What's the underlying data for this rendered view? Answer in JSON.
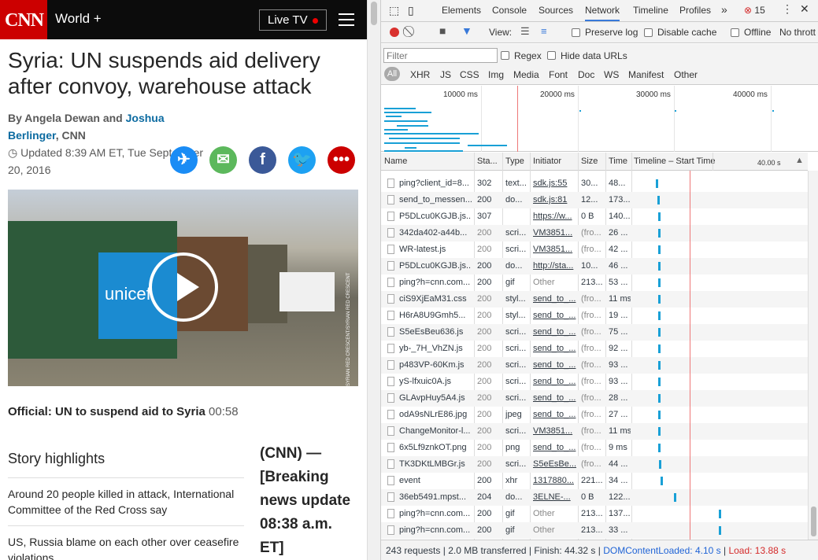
{
  "cnn": {
    "logo": "CNN",
    "section": "World +",
    "live_tv": "Live TV",
    "headline": "Syria: UN suspends aid delivery after convoy, warehouse attack",
    "byline_by": "By Angela Dewan and ",
    "byline_author2": "Joshua Berlinger",
    "byline_org": ", CNN",
    "updated": "Updated 8:39 AM ET, Tue September 20, 2016",
    "video_caption_title": "Official: UN to suspend aid to Syria",
    "video_caption_duration": "00:58",
    "highlights_title": "Story highlights",
    "highlights": [
      "Around 20 people killed in attack, International Committee of the Red Cross say",
      "US, Russia blame on each other over ceasefire violations"
    ],
    "lede": "(CNN) — [Breaking news update 08:38 a.m. ET]",
    "share_colors": {
      "messenger": "#1a8cf5",
      "email": "#5cb85c",
      "facebook": "#3b5998",
      "twitter": "#1da1f2",
      "more": "#cc0000"
    },
    "video_text": "unicef",
    "video_credit": "SYRIAN RED CRESCENT/SYRIAN RED CRESCENT"
  },
  "devtools": {
    "tabs": [
      "Elements",
      "Console",
      "Sources",
      "Network",
      "Timeline",
      "Profiles"
    ],
    "active_tab": "Network",
    "error_count": "15",
    "view_label": "View:",
    "preserve_log": "Preserve log",
    "disable_cache": "Disable cache",
    "offline": "Offline",
    "throttle": "No thrott",
    "filter_placeholder": "Filter",
    "regex": "Regex",
    "hide_data_urls": "Hide data URLs",
    "filter_types": [
      "All",
      "XHR",
      "JS",
      "CSS",
      "Img",
      "Media",
      "Font",
      "Doc",
      "WS",
      "Manifest",
      "Other"
    ],
    "overview_ticks": [
      "10000 ms",
      "20000 ms",
      "30000 ms",
      "40000 ms"
    ],
    "columns": [
      "Name",
      "Sta...",
      "Type",
      "Initiator",
      "Size",
      "Time",
      "Timeline – Start Time",
      "40.00 s"
    ],
    "rows": [
      {
        "name": "ping?client_id=8...",
        "status": "302",
        "type": "text...",
        "initiator": "sdk.js:55",
        "size": "30...",
        "time": "48...",
        "wf": 0.14,
        "link": true,
        "muted": false
      },
      {
        "name": "send_to_messen...",
        "status": "200",
        "type": "do...",
        "initiator": "sdk.js:81",
        "size": "12...",
        "time": "173...",
        "wf": 0.15,
        "link": true,
        "muted": false
      },
      {
        "name": "P5DLcu0KGJB.js...",
        "status": "307",
        "type": "",
        "initiator": "https://w...",
        "size": "0 B",
        "time": "140...",
        "wf": 0.155,
        "link": true,
        "muted": false
      },
      {
        "name": "342da402-a44b...",
        "status": "200",
        "type": "scri...",
        "initiator": "VM3851...",
        "size": "(fro...",
        "time": "26 ...",
        "wf": 0.155,
        "link": true,
        "muted": true
      },
      {
        "name": "WR-latest.js",
        "status": "200",
        "type": "scri...",
        "initiator": "VM3851...",
        "size": "(fro...",
        "time": "42 ...",
        "wf": 0.155,
        "link": true,
        "muted": true
      },
      {
        "name": "P5DLcu0KGJB.js...",
        "status": "200",
        "type": "do...",
        "initiator": "http://sta...",
        "size": "10...",
        "time": "46 ...",
        "wf": 0.155,
        "link": true,
        "muted": false
      },
      {
        "name": "ping?h=cnn.com...",
        "status": "200",
        "type": "gif",
        "initiator": "Other",
        "size": "213...",
        "time": "53 ...",
        "wf": 0.155,
        "link": false,
        "muted": false
      },
      {
        "name": "ciS9XjEaM31.css",
        "status": "200",
        "type": "styl...",
        "initiator": "send_to_...",
        "size": "(fro...",
        "time": "11 ms",
        "wf": 0.155,
        "link": true,
        "muted": true
      },
      {
        "name": "H6rA8U9Gmh5...",
        "status": "200",
        "type": "styl...",
        "initiator": "send_to_...",
        "size": "(fro...",
        "time": "19 ...",
        "wf": 0.155,
        "link": true,
        "muted": true
      },
      {
        "name": "S5eEsBeu636.js",
        "status": "200",
        "type": "scri...",
        "initiator": "send_to_...",
        "size": "(fro...",
        "time": "75 ...",
        "wf": 0.155,
        "link": true,
        "muted": true
      },
      {
        "name": "yb-_7H_VhZN.js",
        "status": "200",
        "type": "scri...",
        "initiator": "send_to_...",
        "size": "(fro...",
        "time": "92 ...",
        "wf": 0.155,
        "link": true,
        "muted": true
      },
      {
        "name": "p483VP-60Km.js",
        "status": "200",
        "type": "scri...",
        "initiator": "send_to_...",
        "size": "(fro...",
        "time": "93 ...",
        "wf": 0.155,
        "link": true,
        "muted": true
      },
      {
        "name": "yS-lfxuic0A.js",
        "status": "200",
        "type": "scri...",
        "initiator": "send_to_...",
        "size": "(fro...",
        "time": "93 ...",
        "wf": 0.155,
        "link": true,
        "muted": true
      },
      {
        "name": "GLAvpHuy5A4.js",
        "status": "200",
        "type": "scri...",
        "initiator": "send_to_...",
        "size": "(fro...",
        "time": "28 ...",
        "wf": 0.155,
        "link": true,
        "muted": true
      },
      {
        "name": "odA9sNLrE86.jpg",
        "status": "200",
        "type": "jpeg",
        "initiator": "send_to_...",
        "size": "(fro...",
        "time": "27 ...",
        "wf": 0.155,
        "link": true,
        "muted": true
      },
      {
        "name": "ChangeMonitor-l...",
        "status": "200",
        "type": "scri...",
        "initiator": "VM3851...",
        "size": "(fro...",
        "time": "11 ms",
        "wf": 0.155,
        "link": true,
        "muted": true
      },
      {
        "name": "6x5Lf9znkOT.png",
        "status": "200",
        "type": "png",
        "initiator": "send_to_...",
        "size": "(fro...",
        "time": "9 ms",
        "wf": 0.155,
        "link": true,
        "muted": true
      },
      {
        "name": "TK3DKtLMBGr.js",
        "status": "200",
        "type": "scri...",
        "initiator": "S5eEsBe...",
        "size": "(fro...",
        "time": "44 ...",
        "wf": 0.16,
        "link": true,
        "muted": true
      },
      {
        "name": "event",
        "status": "200",
        "type": "xhr",
        "initiator": "1317880...",
        "size": "221...",
        "time": "34 ...",
        "wf": 0.17,
        "link": true,
        "muted": false
      },
      {
        "name": "36eb5491.mpst...",
        "status": "204",
        "type": "do...",
        "initiator": "3ELNE-...",
        "size": "0 B",
        "time": "122...",
        "wf": 0.255,
        "link": true,
        "muted": false
      },
      {
        "name": "ping?h=cnn.com...",
        "status": "200",
        "type": "gif",
        "initiator": "Other",
        "size": "213...",
        "time": "137...",
        "wf": 0.54,
        "link": false,
        "muted": false
      },
      {
        "name": "ping?h=cnn.com...",
        "status": "200",
        "type": "gif",
        "initiator": "Other",
        "size": "213...",
        "time": "33 ...",
        "wf": 0.54,
        "link": false,
        "muted": false
      }
    ],
    "status_requests": "243 requests",
    "status_transferred": "2.0 MB transferred",
    "status_finish": "Finish: 44.32 s",
    "status_dcl": "DOMContentLoaded: 4.10 s",
    "status_load": "Load: 13.88 s"
  }
}
